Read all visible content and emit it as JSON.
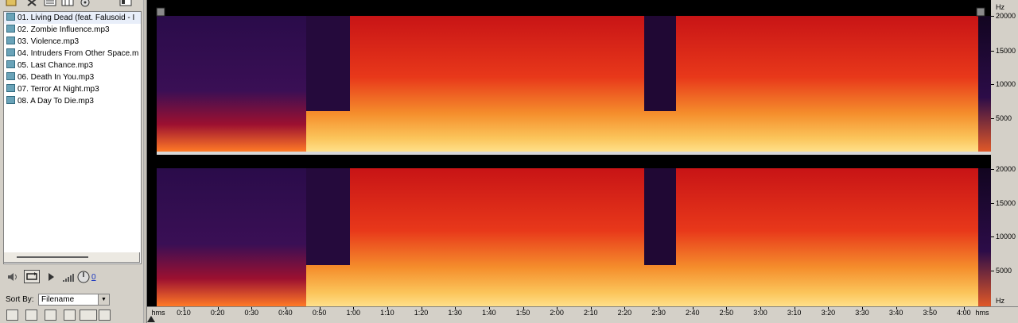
{
  "files": [
    {
      "name": "01. Living Dead (feat. Falusoid - I",
      "selected": true
    },
    {
      "name": "02. Zombie Influence.mp3"
    },
    {
      "name": "03. Violence.mp3"
    },
    {
      "name": "04. Intruders From Other Space.m"
    },
    {
      "name": "05. Last Chance.mp3"
    },
    {
      "name": "06. Death In You.mp3"
    },
    {
      "name": "07. Terror At Night.mp3"
    },
    {
      "name": "08. A Day To Die.mp3"
    }
  ],
  "transport": {
    "counter": "0"
  },
  "sort": {
    "label": "Sort By:",
    "value": "Filename"
  },
  "freq_scale": {
    "unit": "Hz",
    "ticks_top": [
      "20000",
      "15000",
      "10000",
      "5000"
    ],
    "ticks_bottom": [
      "20000",
      "15000",
      "10000",
      "5000"
    ],
    "unit_bottom": "Hz"
  },
  "ruler": {
    "unit_left": "hms",
    "unit_right": "hms",
    "labels": [
      "0:10",
      "0:20",
      "0:30",
      "0:40",
      "0:50",
      "1:00",
      "1:10",
      "1:20",
      "1:30",
      "1:40",
      "1:50",
      "2:00",
      "2:10",
      "2:20",
      "2:30",
      "2:40",
      "2:50",
      "3:00",
      "3:10",
      "3:20",
      "3:30",
      "3:40",
      "3:50",
      "4:00"
    ]
  },
  "colors": {
    "spectrogram_low": "#000000",
    "spectrogram_mid": "#3a1050",
    "spectrogram_high": "#d01010",
    "spectrogram_peak": "#ffd060",
    "panel": "#d4d0c8"
  }
}
